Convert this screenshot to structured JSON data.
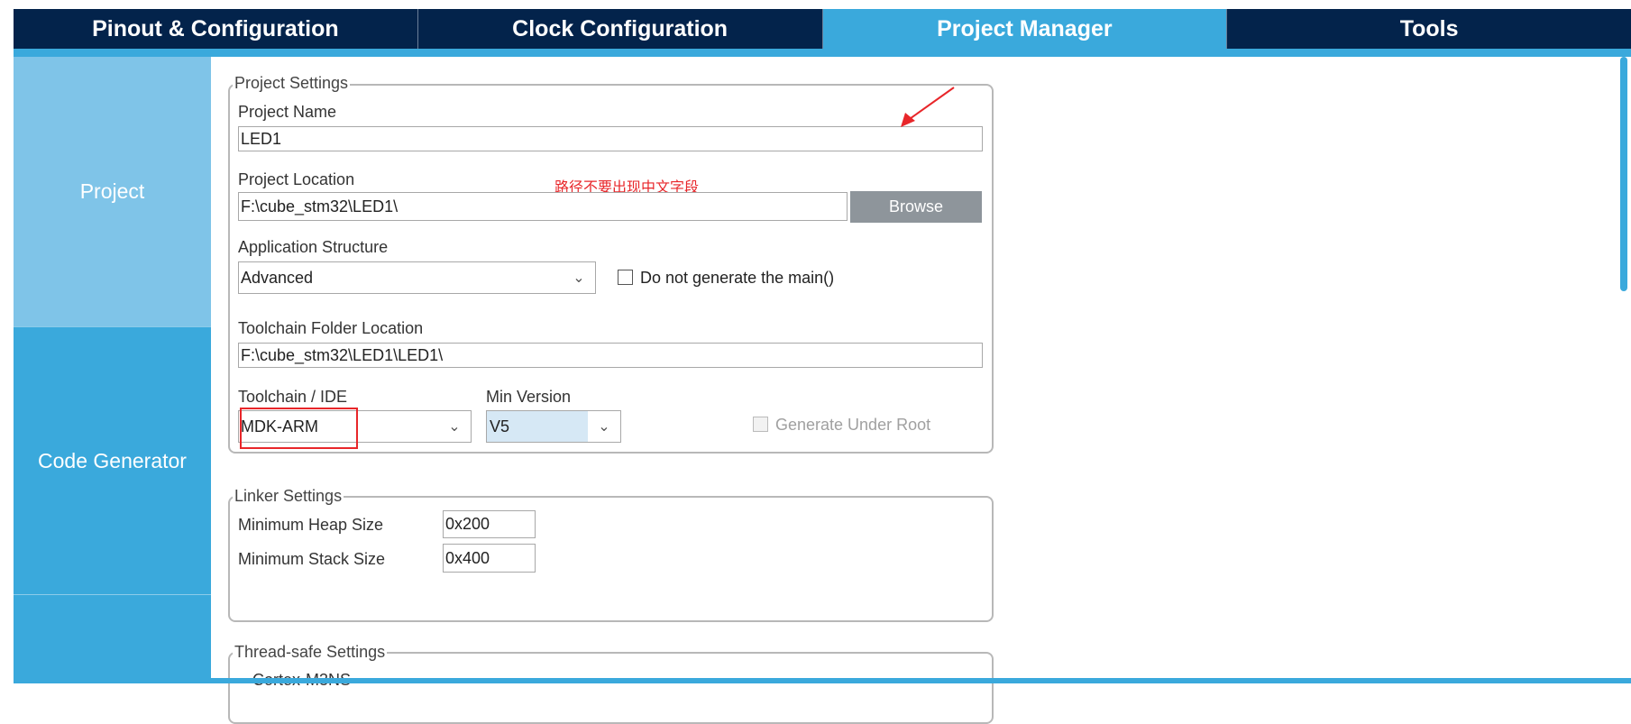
{
  "tabs": [
    {
      "label": "Pinout & Configuration"
    },
    {
      "label": "Clock Configuration"
    },
    {
      "label": "Project Manager",
      "active": true
    },
    {
      "label": "Tools"
    }
  ],
  "sidebar": {
    "items": [
      {
        "label": "Project",
        "active": true
      },
      {
        "label": "Code Generator"
      },
      {
        "label": ""
      }
    ]
  },
  "colors": {
    "nav": "#03234b",
    "accent": "#3aa9dc",
    "sidebar_active": "#7fc4e8",
    "annotation": "#e8262a"
  },
  "project_settings": {
    "legend": "Project Settings",
    "project_name_label": "Project Name",
    "project_name": "LED1",
    "project_location_label": "Project Location",
    "project_location": "F:\\cube_stm32\\LED1\\",
    "browse": "Browse",
    "annotation_note": "路径不要出现中文字段",
    "app_structure_label": "Application Structure",
    "app_structure": "Advanced",
    "no_main_label": "Do not generate the main()",
    "no_main_checked": false,
    "toolchain_folder_label": "Toolchain Folder Location",
    "toolchain_folder": "F:\\cube_stm32\\LED1\\LED1\\",
    "toolchain_label": "Toolchain / IDE",
    "toolchain": "MDK-ARM",
    "min_version_label": "Min Version",
    "min_version": "V5",
    "gen_root_label": "Generate Under Root",
    "gen_root_checked": false,
    "gen_root_disabled": true
  },
  "linker_settings": {
    "legend": "Linker Settings",
    "heap_label": "Minimum Heap Size",
    "heap": "0x200",
    "stack_label": "Minimum Stack Size",
    "stack": "0x400"
  },
  "thread_safe": {
    "legend": "Thread-safe Settings",
    "first_item": "Cortex-M3NS"
  }
}
